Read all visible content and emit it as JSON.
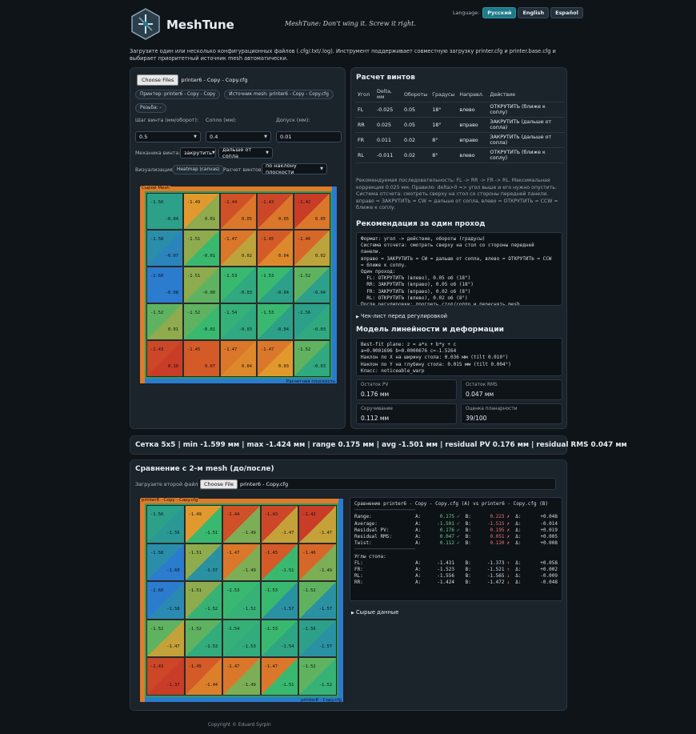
{
  "header": {
    "app_name": "MeshTune",
    "tagline": "MeshTune: Don't wing it. Screw it right.",
    "language_label": "Language:",
    "languages": [
      "Русский",
      "English",
      "Español"
    ],
    "active_language": "Русский"
  },
  "intro": "Загрузите один или несколько конфигурационных файлов (.cfg/.txt/.log). Инструмент поддерживает совместную загрузку printer.cfg и printer.base.cfg и выбирает приоритетный источник mesh автоматически.",
  "left": {
    "choose_file_label": "Choose Files",
    "file_name": "printer6 - Copy - Copy.cfg",
    "pill_printer": "Принтер: printer6 - Copy - Copy",
    "pill_mesh_source": "Источник mesh: printer6 - Copy - Copy.cfg",
    "pill_thread": "Резьба: -",
    "screw_pitch_label": "Шаг винта (мм/оборот):",
    "screw_pitch_value": "0.5",
    "nozzle_label": "Сопло (мм):",
    "nozzle_value": "0.4",
    "tolerance_label": "Допуск (мм):",
    "tolerance_value": "0.01",
    "mechanics_label": "Механика винта:",
    "mechanics_value_1": "закрутить",
    "mechanics_value_2": "дальше от сопла",
    "viz_label": "Визуализация:",
    "viz_value": "Heatmap (canvas)",
    "calc_label": "Расчет винтов:",
    "calc_value": "по наклону плоскости",
    "heatmap_title": "Сырой Mesh",
    "heatmap_footer": "Расчетная плоскость"
  },
  "heatmap_raw": {
    "rows": [
      [
        {
          "a": "-1.56",
          "b": "-0.04"
        },
        {
          "a": "-1.49",
          "b": "0.01"
        },
        {
          "a": "-1.44",
          "b": "0.05"
        },
        {
          "a": "-1.43",
          "b": "0.05"
        },
        {
          "a": "-1.42",
          "b": "0.05"
        }
      ],
      [
        {
          "a": "-1.58",
          "b": "-0.07"
        },
        {
          "a": "-1.51",
          "b": "-0.01"
        },
        {
          "a": "-1.47",
          "b": "0.02"
        },
        {
          "a": "-1.45",
          "b": "0.04"
        },
        {
          "a": "-1.46",
          "b": "0.02"
        }
      ],
      [
        {
          "a": "-1.60",
          "b": "-0.08"
        },
        {
          "a": "-1.51",
          "b": "-0.00"
        },
        {
          "a": "-1.53",
          "b": "-0.03"
        },
        {
          "a": "-1.53",
          "b": "-0.04"
        },
        {
          "a": "-1.52",
          "b": "-0.04"
        }
      ],
      [
        {
          "a": "-1.52",
          "b": "0.01"
        },
        {
          "a": "-1.52",
          "b": "-0.01"
        },
        {
          "a": "-1.54",
          "b": "-0.03"
        },
        {
          "a": "-1.53",
          "b": "-0.04"
        },
        {
          "a": "-1.56",
          "b": "-0.03"
        }
      ],
      [
        {
          "a": "-1.43",
          "b": "0.10"
        },
        {
          "a": "-1.45",
          "b": "0.07"
        },
        {
          "a": "-1.47",
          "b": "0.04"
        },
        {
          "a": "-1.47",
          "b": "0.03"
        },
        {
          "a": "-1.52",
          "b": "-0.03"
        }
      ]
    ]
  },
  "screws": {
    "title": "Расчет винтов",
    "headers": [
      "Угол",
      "Delta, мм",
      "Обороты",
      "Градусы",
      "Направл.",
      "Действие"
    ],
    "rows": [
      {
        "corner": "FL",
        "delta": "-0.025",
        "turns": "0.05",
        "deg": "18°",
        "dir": "влево",
        "action": "ОТКРУТИТЬ (ближе к соплу)",
        "kind": "loosen"
      },
      {
        "corner": "RR",
        "delta": "0.025",
        "turns": "0.05",
        "deg": "18°",
        "dir": "вправо",
        "action": "ЗАКРУТИТЬ (дальше от сопла)",
        "kind": "tighten"
      },
      {
        "corner": "FR",
        "delta": "0.011",
        "turns": "0.02",
        "deg": "8°",
        "dir": "вправо",
        "action": "ЗАКРУТИТЬ (дальше от сопла)",
        "kind": "tighten"
      },
      {
        "corner": "RL",
        "delta": "-0.011",
        "turns": "0.02",
        "deg": "8°",
        "dir": "влево",
        "action": "ОТКРУТИТЬ (ближе к соплу)",
        "kind": "loosen"
      }
    ],
    "note": "Рекомендуемая последовательность: FL -> RR -> FR -> RL. Максимальная коррекция 0.025 мм. Правило: delta>0 => угол выше и его нужно опустить. Система отсчета: смотреть сверху на стол со стороны передней панели. вправо = ЗАКРУТИТЬ = CW = дальше от сопла, влево = ОТКРУТИТЬ = CCW = ближе к соплу."
  },
  "pass": {
    "title": "Рекомендация за один проход",
    "text": "Формат: угол -> действие, обороты (градусы)\nСистема отсчета: смотреть сверху на стол со стороны передней\nпанели.\nвправо = ЗАКРУТИТЬ = CW = дальше от сопла, влево = ОТКРУТИТЬ = CCW\n= ближе к соплу.\nОдин проход:\n  FL: ОТКРУТИТЬ (влево), 0.05 об (18°)\n  RR: ЗАКРУТИТЬ (вправо), 0.05 об (18°)\n  FR: ЗАКРУТИТЬ (вправо), 0.02 об (8°)\n  RL: ОТКРУТИТЬ (влево), 0.02 об (8°)\nПосле регулировки: прогреть стол/сопло и переснять mesh."
  },
  "checklist_label": "Чек-лист перед регулировкой",
  "linearity": {
    "title": "Модель линейности и деформации",
    "text": "Best-fit plane: z = a*x + b*y + c\na=0.0001696 b=0.0000676 c=-1.5264\nНаклон по X на ширину стола: 0.036 мм (tilt 0.010°)\nНаклон по Y на глубину стола: 0.015 мм (tilt 0.004°)\nКласс: noticeable_warp",
    "stats": [
      {
        "k": "Остаток PV",
        "v": "0.176 мм"
      },
      {
        "k": "Остаток RMS",
        "v": "0.047 мм"
      },
      {
        "k": "Скручивание",
        "v": "0.112 мм"
      },
      {
        "k": "Оценка планарности",
        "v": "39/100"
      }
    ]
  },
  "summary": "Сетка 5x5 | min -1.599 мм | max -1.424 мм | range 0.175 мм | avg -1.501 мм | residual PV 0.176 мм | residual RMS 0.047 мм",
  "compare": {
    "title": "Сравнение с 2-м mesh (до/после)",
    "upload_label": "Загрузите второй файл:",
    "choose_file_label": "Choose File",
    "file_name": "printer6 - Copy.cfg",
    "heatmap_title": "printer6 - Copy - Copy.cfg",
    "heatmap_footer": "printer6 - Copy.cfg",
    "header_line": "Сравнение printer6 - Copy - Copy.cfg (A) vs printer6 - Copy.cfg (B)",
    "metrics": [
      {
        "name": "Range:",
        "a": "0.175",
        "am": "✓",
        "b": "0.223",
        "bm": "✗",
        "d": "+0.048"
      },
      {
        "name": "Average:",
        "a": "-1.501",
        "am": "✓",
        "b": "-1.515",
        "bm": "✗",
        "d": "-0.014"
      },
      {
        "name": "Residual PV:",
        "a": "0.176",
        "am": "✓",
        "b": "0.195",
        "bm": "✗",
        "d": "+0.019"
      },
      {
        "name": "Residual RMS:",
        "a": "0.047",
        "am": "✓",
        "b": "0.051",
        "bm": "✗",
        "d": "+0.005"
      },
      {
        "name": "Twist:",
        "a": "0.112",
        "am": "✓",
        "b": "0.120",
        "bm": "✗",
        "d": "+0.008"
      }
    ],
    "corners_title": "Углы стола:",
    "corners": [
      {
        "name": "FL:",
        "a": "-1.431",
        "b": "-1.373",
        "bm": "↑",
        "d": "+0.058"
      },
      {
        "name": "FR:",
        "a": "-1.523",
        "b": "-1.521",
        "bm": "↑",
        "d": "+0.002"
      },
      {
        "name": "RL:",
        "a": "-1.556",
        "b": "-1.565",
        "bm": "↓",
        "d": "-0.009"
      },
      {
        "name": "RR:",
        "a": "-1.424",
        "b": "-1.472",
        "bm": "↓",
        "d": "-0.048"
      }
    ],
    "raw_label": "Сырые данные",
    "rows": [
      [
        {
          "a": "-1.56",
          "b": "-1.56"
        },
        {
          "a": "-1.49",
          "b": "-1.51"
        },
        {
          "a": "-1.44",
          "b": "-1.49"
        },
        {
          "a": "-1.43",
          "b": "-1.47"
        },
        {
          "a": "-1.42",
          "b": "-1.47"
        }
      ],
      [
        {
          "a": "-1.58",
          "b": "-1.60"
        },
        {
          "a": "-1.51",
          "b": "-1.57"
        },
        {
          "a": "-1.47",
          "b": "-1.49"
        },
        {
          "a": "-1.45",
          "b": "-1.51"
        },
        {
          "a": "-1.46",
          "b": "-1.49"
        }
      ],
      [
        {
          "a": "-1.60",
          "b": "-1.58"
        },
        {
          "a": "-1.51",
          "b": "-1.52"
        },
        {
          "a": "-1.53",
          "b": "-1.52"
        },
        {
          "a": "-1.53",
          "b": "-1.57"
        },
        {
          "a": "-1.52",
          "b": "-1.57"
        }
      ],
      [
        {
          "a": "-1.52",
          "b": "-1.47"
        },
        {
          "a": "-1.52",
          "b": "-1.53"
        },
        {
          "a": "-1.54",
          "b": "-1.53"
        },
        {
          "a": "-1.53",
          "b": "-1.54"
        },
        {
          "a": "-1.56",
          "b": "-1.57"
        }
      ],
      [
        {
          "a": "-1.43",
          "b": "-1.37"
        },
        {
          "a": "-1.45",
          "b": "-1.44"
        },
        {
          "a": "-1.47",
          "b": "-1.49"
        },
        {
          "a": "-1.47",
          "b": "-1.51"
        },
        {
          "a": "-1.52",
          "b": "-1.52"
        }
      ]
    ]
  },
  "footer": "Copyright © Eduard Syrpin"
}
